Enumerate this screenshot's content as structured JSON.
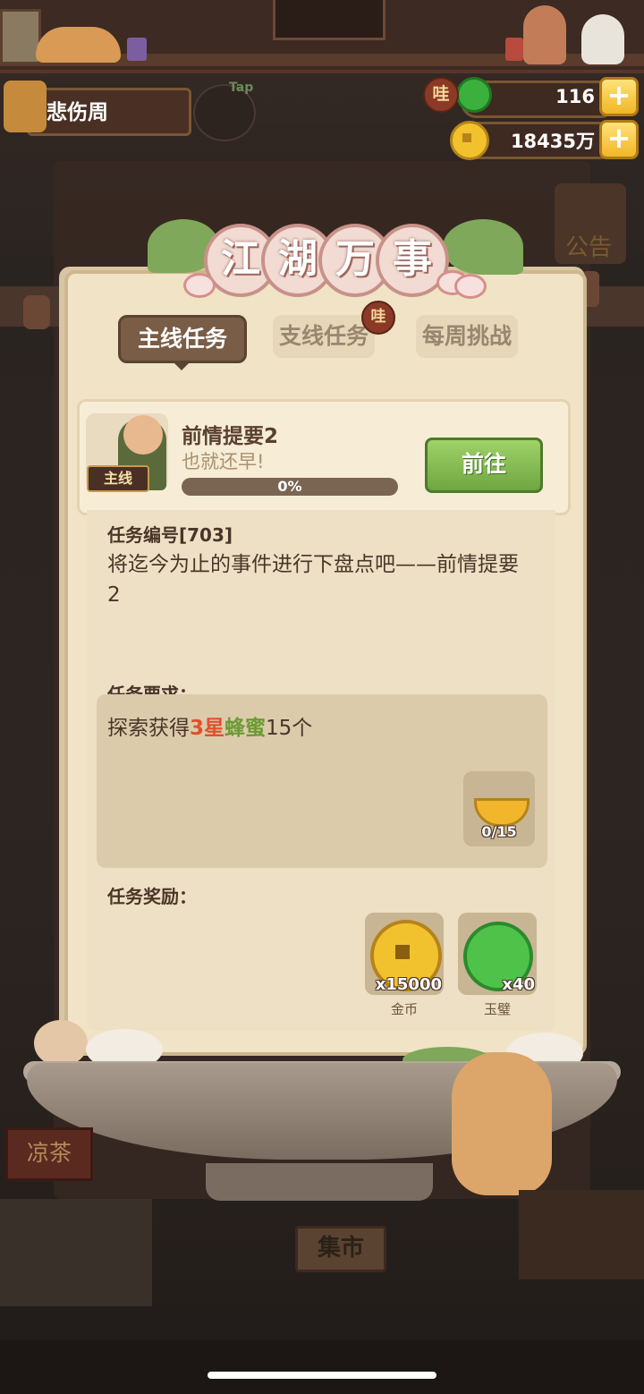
{
  "player": {
    "name": "悲伤周",
    "tap_label": "Tap"
  },
  "resources": {
    "jade": {
      "value": "116",
      "badge": "哇"
    },
    "gold": {
      "value": "18435万"
    },
    "plus_glyph": "+"
  },
  "background": {
    "notice_label": "公告",
    "market_label": "集市",
    "tea_label": "凉茶"
  },
  "title": [
    "江",
    "湖",
    "万",
    "事"
  ],
  "tabs": [
    {
      "label": "主线任务",
      "active": true
    },
    {
      "label": "支线任务",
      "badge": "哇"
    },
    {
      "label": "每周挑战"
    }
  ],
  "quest": {
    "tag": "主线",
    "title": "前情提要2",
    "subtitle": "也就还早!",
    "progress": 0,
    "progress_text": "0%",
    "go_label": "前往"
  },
  "detail": {
    "id_label": "任务编号[703]",
    "description": "将迄今为止的事件进行下盘点吧——前情提要2",
    "requirement_label": "任务要求：",
    "requirement": {
      "prefix": "探索获得",
      "star": "3星",
      "item": "蜂蜜",
      "count": "15个"
    },
    "item_progress": "0/15",
    "reward_label": "任务奖励：",
    "rewards": [
      {
        "name": "金币",
        "count": "x15000",
        "icon": "gold-coin-icon"
      },
      {
        "name": "玉璧",
        "count": "x40",
        "icon": "jade-disc-icon"
      }
    ]
  },
  "colors": {
    "accent_green": "#9bc45a",
    "star_red": "#e0512a",
    "item_green": "#6b9a32"
  }
}
